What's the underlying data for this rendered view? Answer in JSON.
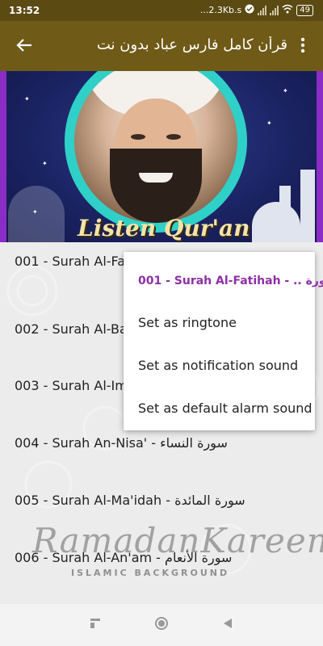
{
  "status_bar": {
    "time": "13:52",
    "network_speed": "...2.3Kb.s",
    "battery": "49",
    "icons": [
      "check-circle-icon",
      "signal-icon",
      "signal-icon",
      "wifi-icon",
      "battery-icon"
    ]
  },
  "app_bar": {
    "title": "قرأن كامل فارس عباد بدون نت",
    "back_icon": "arrow-back-icon",
    "menu_icon": "more-vert-icon",
    "color": "#6f5a17"
  },
  "banner": {
    "caption": "Listen Qur'an"
  },
  "list": {
    "items": [
      {
        "label": "001 - Surah Al-Fatihah - سورة الفاتحة"
      },
      {
        "label": "002 - Surah Al-Baqarah - سورة البقرة"
      },
      {
        "label": "003 - Surah Al-Imran - سورة آل عمران"
      },
      {
        "label": "004 - Surah An-Nisa' - سورة النساء"
      },
      {
        "label": "005 - Surah Al-Ma'idah - سورة المائدة"
      },
      {
        "label": "006 - Surah Al-An'am - سورة الأنعام"
      }
    ],
    "background_title": "RamadanKareem",
    "background_subtitle": "ISLAMIC BACKGROUND"
  },
  "popup_menu": {
    "header": "001 - Surah Al-Fatihah - .. سورة",
    "header_color": "#8e2fa6",
    "items": [
      {
        "label": "Set as ringtone"
      },
      {
        "label": "Set as notification sound"
      },
      {
        "label": "Set as default alarm sound"
      }
    ]
  },
  "nav_bar": {
    "icons": [
      "recents-icon",
      "home-icon",
      "back-icon"
    ]
  }
}
